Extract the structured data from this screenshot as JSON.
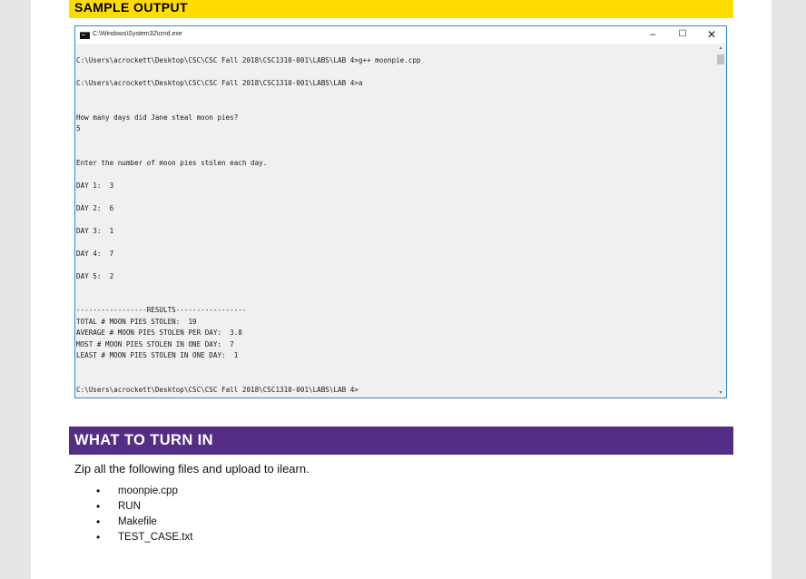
{
  "sample_output": {
    "heading": "SAMPLE OUTPUT",
    "window": {
      "title": "C:\\Windows\\System32\\cmd.exe",
      "minimize_glyph": "–",
      "maximize_glyph": "☐",
      "close_glyph": "✕",
      "scroll_up_glyph": "▲",
      "scroll_down_glyph": "▼"
    },
    "console_lines": [
      "C:\\Users\\acrockett\\Desktop\\CSC\\CSC Fall 2018\\CSC1310-001\\LABS\\LAB 4>g++ moonpie.cpp",
      "",
      "C:\\Users\\acrockett\\Desktop\\CSC\\CSC Fall 2018\\CSC1310-001\\LABS\\LAB 4>a",
      "",
      "",
      "How many days did Jane steal moon pies?",
      "5",
      "",
      "",
      "Enter the number of moon pies stolen each day.",
      "",
      "DAY 1:  3",
      "",
      "DAY 2:  6",
      "",
      "DAY 3:  1",
      "",
      "DAY 4:  7",
      "",
      "DAY 5:  2",
      "",
      "",
      "-----------------RESULTS-----------------",
      "TOTAL # MOON PIES STOLEN:  19",
      "AVERAGE # MOON PIES STOLEN PER DAY:  3.8",
      "MOST # MOON PIES STOLEN IN ONE DAY:  7",
      "LEAST # MOON PIES STOLEN IN ONE DAY:  1",
      "",
      "",
      "C:\\Users\\acrockett\\Desktop\\CSC\\CSC Fall 2018\\CSC1310-001\\LABS\\LAB 4>"
    ]
  },
  "turn_in": {
    "heading": "WHAT TO TURN IN",
    "instruction": "Zip all the following files and upload to ilearn.",
    "bullet_glyph": "•",
    "files": [
      "moonpie.cpp",
      "RUN",
      "Makefile",
      "TEST_CASE.txt"
    ]
  },
  "colors": {
    "sample_banner": "#ffdc00",
    "turn_in_banner": "#542d84",
    "console_background": "#f0f0f0",
    "window_border": "#2a8ad4"
  },
  "icons": {
    "window_icon": "cmd-icon",
    "scroll": "scrollbar-arrows",
    "list_marker": "bullet"
  }
}
